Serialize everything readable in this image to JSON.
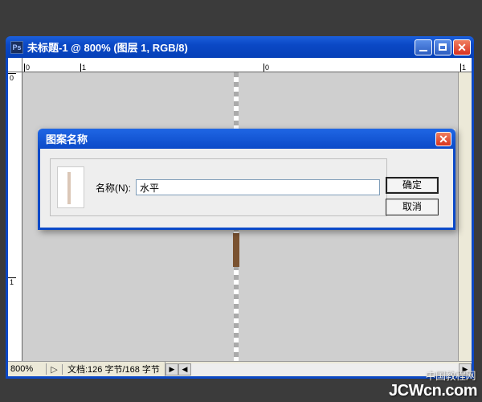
{
  "window": {
    "title": "未标题-1 @ 800% (图层 1, RGB/8)",
    "icon_label": "Ps"
  },
  "ruler": {
    "h_ticks": [
      "0",
      "1",
      "0",
      "1"
    ],
    "v_ticks": [
      "0",
      "1"
    ]
  },
  "status": {
    "zoom": "800%",
    "doc": "文档:126 字节/168 字节"
  },
  "dialog": {
    "title": "图案名称",
    "name_label": "名称(N):",
    "name_value": "水平",
    "ok": "确定",
    "cancel": "取消"
  },
  "watermark": {
    "cn": "中国教程网",
    "en": "JCWcn.com"
  }
}
